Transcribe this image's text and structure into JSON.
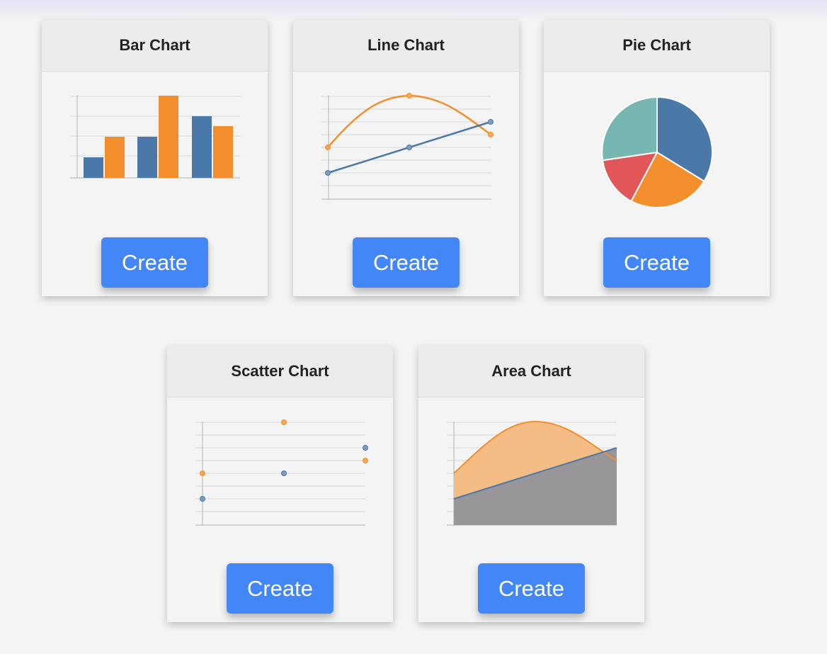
{
  "cards": [
    {
      "title": "Bar Chart",
      "button": "Create",
      "thumbnail_type": "bar"
    },
    {
      "title": "Line Chart",
      "button": "Create",
      "thumbnail_type": "line"
    },
    {
      "title": "Pie Chart",
      "button": "Create",
      "thumbnail_type": "pie"
    },
    {
      "title": "Scatter Chart",
      "button": "Create",
      "thumbnail_type": "scatter"
    },
    {
      "title": "Area Chart",
      "button": "Create",
      "thumbnail_type": "area"
    }
  ],
  "colors": {
    "blue": "#4a78a8",
    "orange": "#f28f2c",
    "red": "#e15759",
    "teal": "#76b7b2",
    "button": "#4287f5"
  }
}
